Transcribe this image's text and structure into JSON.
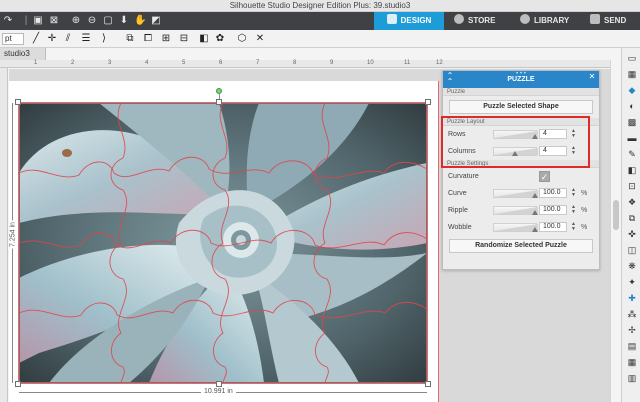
{
  "app": {
    "title": "Silhouette Studio Designer Edition Plus: 39.studio3"
  },
  "nav": {
    "design": "DESIGN",
    "store": "STORE",
    "library": "LIBRARY",
    "send": "SEND"
  },
  "toolbar": {
    "unit_field": "pt"
  },
  "document": {
    "tab_label": "studio3"
  },
  "ruler": {
    "ticks": [
      "1",
      "2",
      "3",
      "4",
      "5",
      "6",
      "7",
      "8",
      "9",
      "10",
      "11",
      "12"
    ]
  },
  "canvas": {
    "width_label": "10.991 in",
    "height_label": "7.254 in"
  },
  "panel": {
    "title": "PUZZLE",
    "section_puzzle": "Puzzle",
    "puzzle_button": "Puzzle Selected Shape",
    "section_layout": "Puzzle Layout",
    "rows_label": "Rows",
    "rows_value": "4",
    "columns_label": "Columns",
    "columns_value": "4",
    "section_settings": "Puzzle Settings",
    "curvature_label": "Curvature",
    "curvature_checked": true,
    "curve_label": "Curve",
    "curve_value": "100.0",
    "ripple_label": "Ripple",
    "ripple_value": "100.0",
    "wobble_label": "Wobble",
    "wobble_value": "100.0",
    "percent": "%",
    "randomize_button": "Randomize Selected Puzzle"
  },
  "colors": {
    "accent": "#1d9cd8",
    "panel_header": "#2a86c8",
    "highlight": "#e02a2a",
    "puzzle_lines": "#e0454a"
  }
}
